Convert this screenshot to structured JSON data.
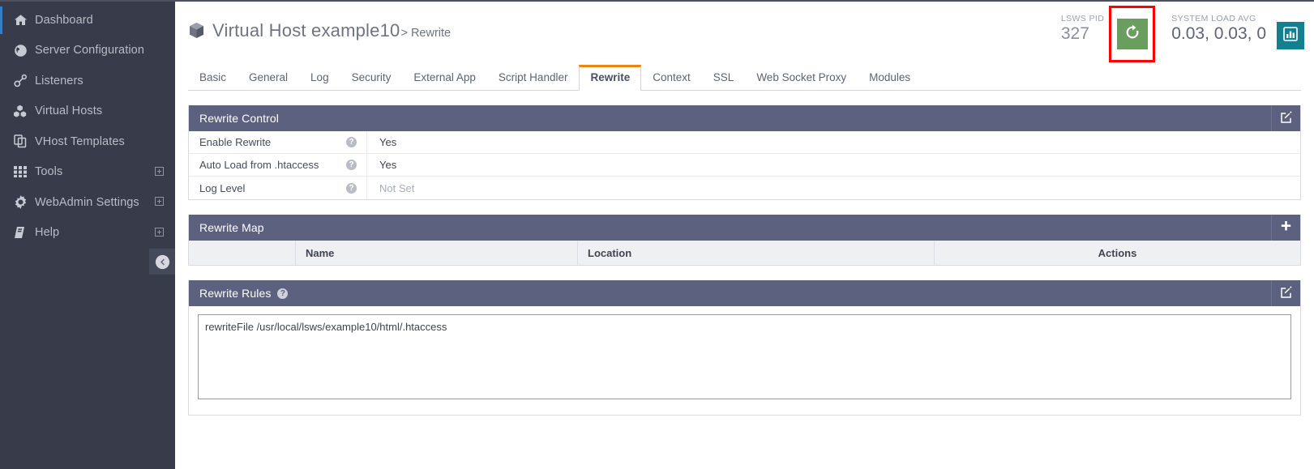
{
  "sidebar": {
    "items": [
      {
        "label": "Dashboard",
        "icon": "home-icon",
        "expandable": false
      },
      {
        "label": "Server Configuration",
        "icon": "globe-icon",
        "expandable": false
      },
      {
        "label": "Listeners",
        "icon": "link-icon",
        "expandable": false
      },
      {
        "label": "Virtual Hosts",
        "icon": "cubes-icon",
        "expandable": false
      },
      {
        "label": "VHost Templates",
        "icon": "copy-icon",
        "expandable": false
      },
      {
        "label": "Tools",
        "icon": "grid-icon",
        "expandable": true
      },
      {
        "label": "WebAdmin Settings",
        "icon": "gear-icon",
        "expandable": true
      },
      {
        "label": "Help",
        "icon": "book-icon",
        "expandable": true
      }
    ],
    "collapse_icon": "arrow-left-circle-icon"
  },
  "header": {
    "icon": "cube-icon",
    "title": "Virtual Host example10",
    "subtitle": "> Rewrite",
    "stats": [
      {
        "label": "LSWS PID",
        "value": "327"
      },
      {
        "label": "SYSTEM LOAD AVG",
        "value": "0.03, 0.03, 0"
      }
    ],
    "refresh_icon": "refresh-icon",
    "chart_icon": "bar-chart-icon",
    "highlight_color": "#ff0000",
    "refresh_color": "#6a9e5f",
    "chart_color": "#147f8f"
  },
  "tabs": [
    {
      "label": "Basic",
      "active": false
    },
    {
      "label": "General",
      "active": false
    },
    {
      "label": "Log",
      "active": false
    },
    {
      "label": "Security",
      "active": false
    },
    {
      "label": "External App",
      "active": false
    },
    {
      "label": "Script Handler",
      "active": false
    },
    {
      "label": "Rewrite",
      "active": true
    },
    {
      "label": "Context",
      "active": false
    },
    {
      "label": "SSL",
      "active": false
    },
    {
      "label": "Web Socket Proxy",
      "active": false
    },
    {
      "label": "Modules",
      "active": false
    }
  ],
  "panels": {
    "rewrite_control": {
      "title": "Rewrite Control",
      "action_icon": "edit-icon",
      "rows": [
        {
          "label": "Enable Rewrite",
          "help": "?",
          "value": "Yes",
          "notset": false
        },
        {
          "label": "Auto Load from .htaccess",
          "help": "?",
          "value": "Yes",
          "notset": false
        },
        {
          "label": "Log Level",
          "help": "?",
          "value": "Not Set",
          "notset": true
        }
      ]
    },
    "rewrite_map": {
      "title": "Rewrite Map",
      "action_icon": "plus-icon",
      "columns": [
        "",
        "Name",
        "Location",
        "Actions"
      ],
      "rows": []
    },
    "rewrite_rules": {
      "title": "Rewrite Rules",
      "help": "?",
      "action_icon": "edit-icon",
      "textarea_value": "rewriteFile /usr/local/lsws/example10/html/.htaccess",
      "textarea_placeholder": ""
    }
  },
  "theme": {
    "sidebar_bg": "#383c4a",
    "panel_head_bg": "#5d6180",
    "tab_accent": "#e8870b"
  }
}
